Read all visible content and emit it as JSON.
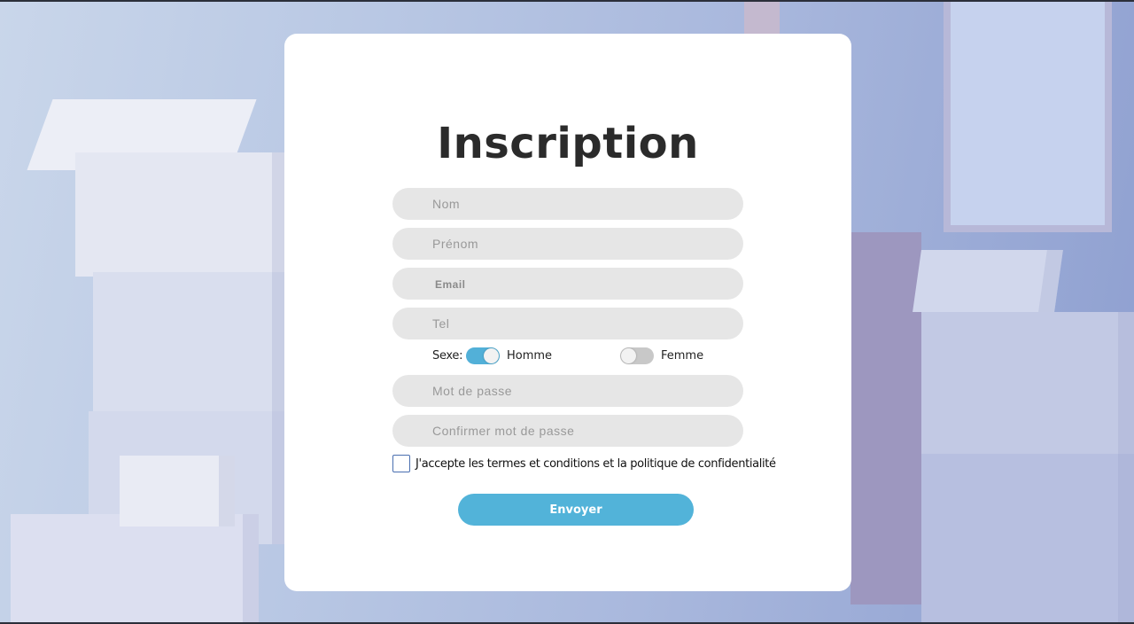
{
  "form": {
    "title": "Inscription",
    "fields": {
      "nom": "Nom",
      "prenom": "Prénom",
      "email": "Email",
      "tel": "Tel",
      "password": "Mot de passe",
      "confirm_password": "Confirmer mot de passe"
    },
    "sexe": {
      "label": "Sexe:",
      "options": [
        {
          "label": "Homme",
          "selected": true
        },
        {
          "label": "Femme",
          "selected": false
        }
      ]
    },
    "terms": {
      "label": "J'accepte les termes et conditions et la politique de confidentialité",
      "checked": false
    },
    "submit_label": "Envoyer"
  },
  "colors": {
    "accent": "#52b3d9",
    "field_bg": "#e6e6e6",
    "card_bg": "#ffffff",
    "title": "#2b2b2b"
  }
}
